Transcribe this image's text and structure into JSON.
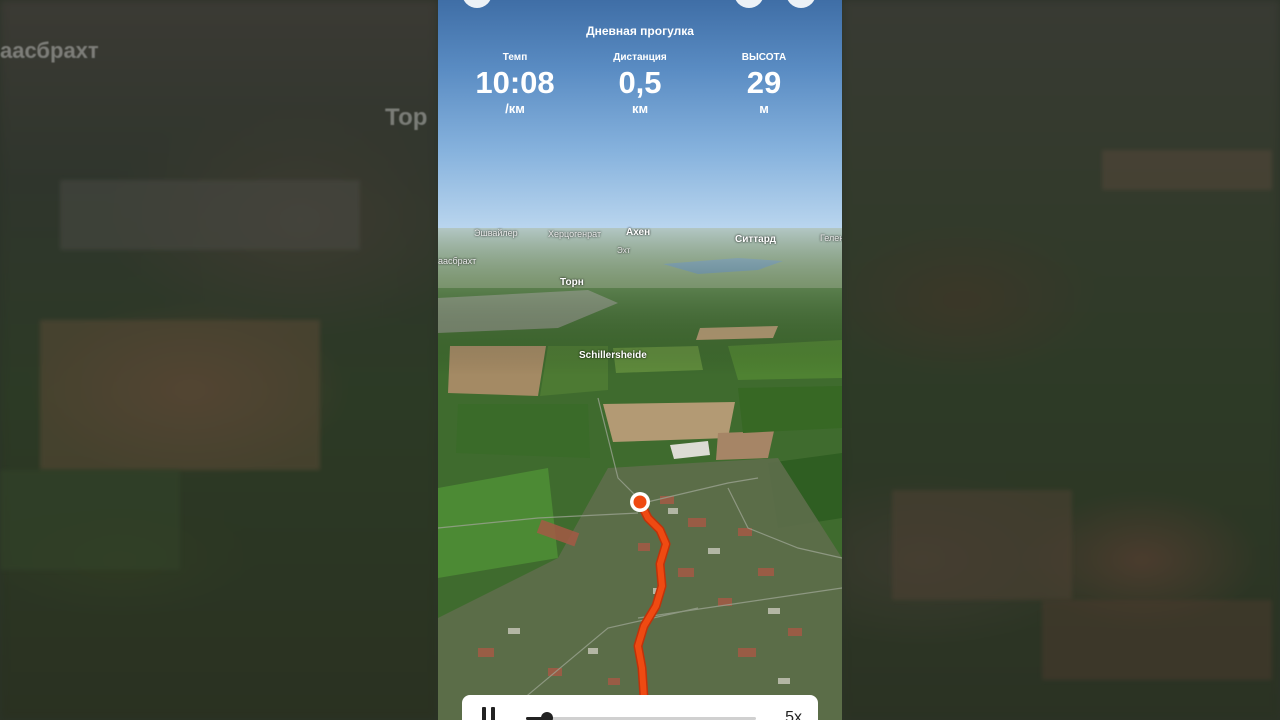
{
  "background": {
    "label_left_top": "аасбрахт",
    "label_left_mid": "Тор"
  },
  "activity": {
    "title": "Дневная прогулка"
  },
  "stats": [
    {
      "label": "Темп",
      "value": "10:08",
      "unit": "/км"
    },
    {
      "label": "Дистанция",
      "value": "0,5",
      "unit": "км"
    },
    {
      "label": "Высота",
      "value": "29",
      "unit": "м"
    }
  ],
  "map_labels": {
    "eschweiler": "Эшвайлер",
    "herzogenrath": "Херцогенрат",
    "aachen": "Ахен",
    "sittard": "Ситтард",
    "geleen": "Гелен",
    "echt": "Эхт",
    "maasbracht": "аасбрахт",
    "thorn": "Торн",
    "schillersheide": "Schillersheide"
  },
  "player": {
    "speed": "5x",
    "progress": 0.09
  },
  "colors": {
    "route": "#ef4a12",
    "sky_top": "#3f6ea6",
    "sky_bottom": "#bcd7ef",
    "player_bg": "#ffffff"
  },
  "icons": {
    "pause": "pause-icon",
    "start_marker": "start-marker-icon"
  }
}
